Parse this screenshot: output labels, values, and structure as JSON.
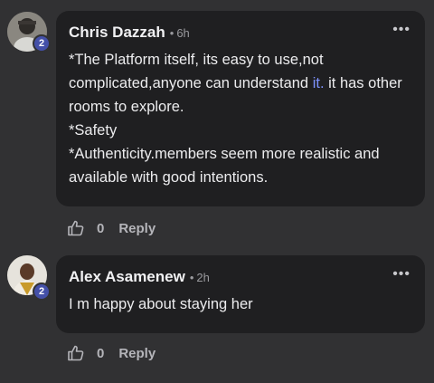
{
  "comments": [
    {
      "author": "Chris Dazzah",
      "time": "6h",
      "separator": "•",
      "badge": "2",
      "more_label": "•••",
      "lines": [
        {
          "pre": "*The Platform itself, its easy to use,not complicated,anyone can understand ",
          "link": "it.",
          "post": " it has other rooms to explore."
        },
        {
          "pre": "*Safety",
          "link": "",
          "post": ""
        },
        {
          "pre": "*Authenticity.members seem more realistic and available with good intentions.",
          "link": "",
          "post": ""
        }
      ],
      "like_count": "0",
      "reply_label": "Reply"
    },
    {
      "author": "Alex Asamenew",
      "time": "2h",
      "separator": "•",
      "badge": "2",
      "more_label": "•••",
      "lines": [
        {
          "pre": "I m happy about staying her",
          "link": "",
          "post": ""
        }
      ],
      "like_count": "0",
      "reply_label": "Reply"
    }
  ],
  "colors": {
    "background": "#313133",
    "bubble": "#1f1f21",
    "badge": "#4450a8",
    "link": "#7e93ff"
  },
  "icons": [
    "like-thumb-icon",
    "more-options-icon"
  ]
}
